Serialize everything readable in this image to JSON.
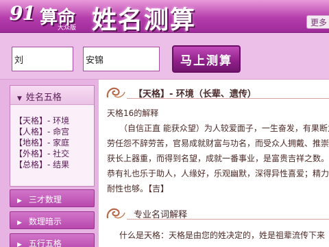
{
  "header": {
    "logo_number": "91",
    "logo_char": "算命",
    "logo_sub": "大众版",
    "title": "姓名测算",
    "more_label": "更多"
  },
  "search": {
    "surname_value": "刘",
    "given_name_value": "安锦",
    "submit_label": "马上测算"
  },
  "sidebar": {
    "wuge_title": "姓名五格",
    "wuge_items": [
      "【天格】- 环境",
      "【人格】- 命宫",
      "【地格】- 家庭",
      "【外格】- 社交",
      "【总格】- 结果"
    ],
    "menu": [
      "三才数理",
      "数理暗示",
      "五行五格"
    ]
  },
  "content": {
    "section1_title": "【天格】- 环境（长辈、遗传）",
    "section1_lines": [
      "天格16的解释",
      "（自信正直 能获众望）为人较爱面子，一生奋发，有果断力",
      "劳任怨不辞劳苦，官易成就财富与功名，而受众人拥戴、推崇",
      "获长上器重，而得到名望，成就一番事业，是富贵吉祥之数。",
      "恭有礼也乐于助人，人缘好，乐观幽默，深得异性喜爱；精力",
      "耐性也够。【吉】"
    ],
    "section2_title": "专业名词解释",
    "section2_lines": [
      "什么是天格：天格是由您的姓决定的，姓是祖辈流传下来"
    ]
  }
}
